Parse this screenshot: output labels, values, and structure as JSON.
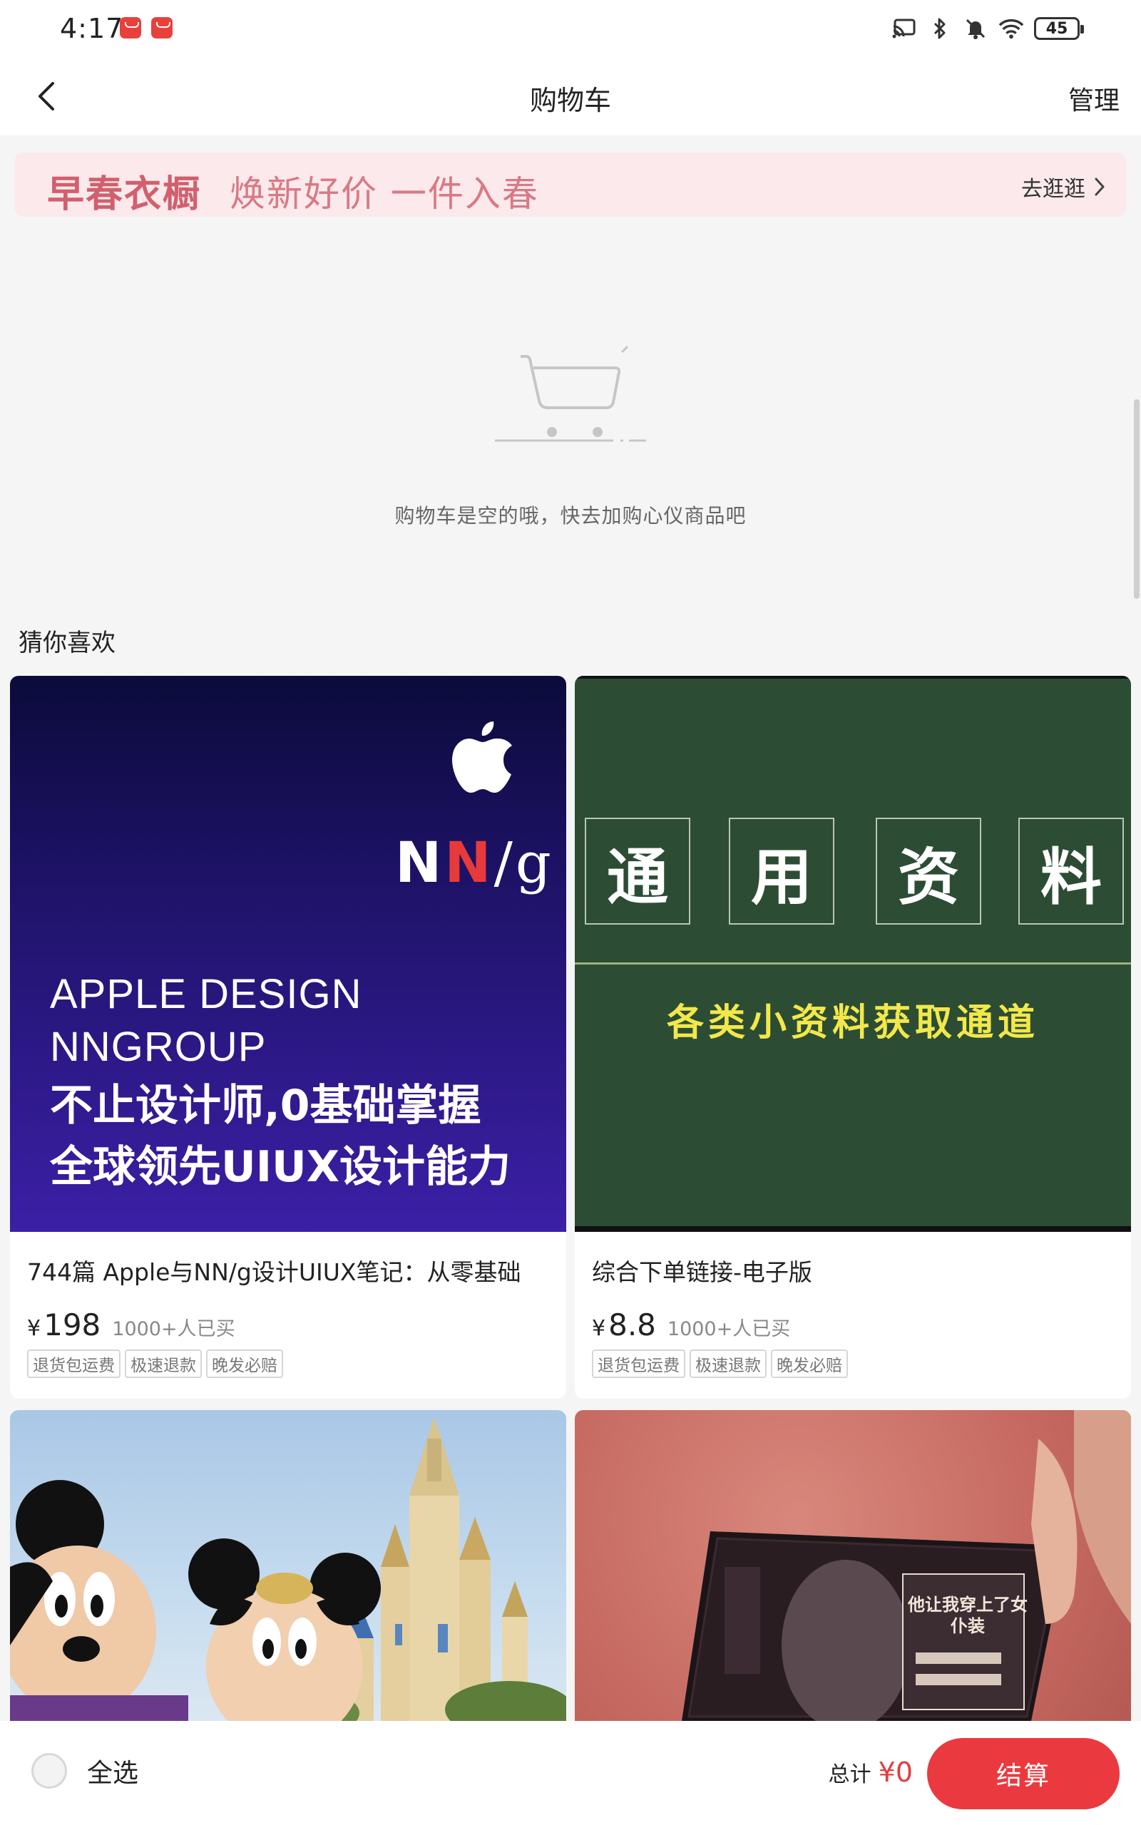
{
  "status_bar": {
    "time": "4:17",
    "battery": "45",
    "icons": [
      "app-notification-icon",
      "app-notification-icon",
      "cast-icon",
      "bluetooth-icon",
      "mute-icon",
      "wifi-icon",
      "battery-icon"
    ]
  },
  "nav": {
    "title": "购物车",
    "manage": "管理",
    "back_icon": "chevron-left-icon"
  },
  "promo": {
    "main": "早春衣橱",
    "sub": "焕新好价 一件入春",
    "link": "去逛逛"
  },
  "empty_state": {
    "text": "购物车是空的哦，快去加购心仪商品吧",
    "icon": "empty-cart-icon"
  },
  "recommend": {
    "title": "猜你喜欢",
    "products": [
      {
        "title": "744篇 Apple与NN/g设计UIUX笔记：从零基础",
        "price_symbol": "¥",
        "price": "198",
        "sold": "1000+人已买",
        "tags": [
          "退货包运费",
          "极速退款",
          "晚发必赔"
        ],
        "image": {
          "brand": "NN/g",
          "en_line1": "APPLE DESIGN",
          "en_line2": "NNGROUP",
          "cn_line1": "不止设计师,0基础掌握",
          "cn_line2": "全球领先UIUX设计能力"
        }
      },
      {
        "title": "综合下单链接-电子版",
        "price_symbol": "¥",
        "price": "8.8",
        "sold": "1000+人已买",
        "tags": [
          "退货包运费",
          "极速退款",
          "晚发必赔"
        ],
        "image": {
          "chars": [
            "通",
            "用",
            "资",
            "料"
          ],
          "subtitle": "各类小资料获取通道"
        }
      },
      {
        "image_desc": "castle-photo"
      },
      {
        "image_desc": "book-photo",
        "image": {
          "book_title": "他让我穿上了女仆装"
        }
      }
    ]
  },
  "bottom": {
    "select_all": "全选",
    "total_label": "总计",
    "total_value": "¥0",
    "checkout": "结算"
  },
  "colors": {
    "accent": "#ea3a3f",
    "promo_bg": "#fbe9eb",
    "promo_text": "#d0606e",
    "page_bg": "#f5f5f5"
  }
}
